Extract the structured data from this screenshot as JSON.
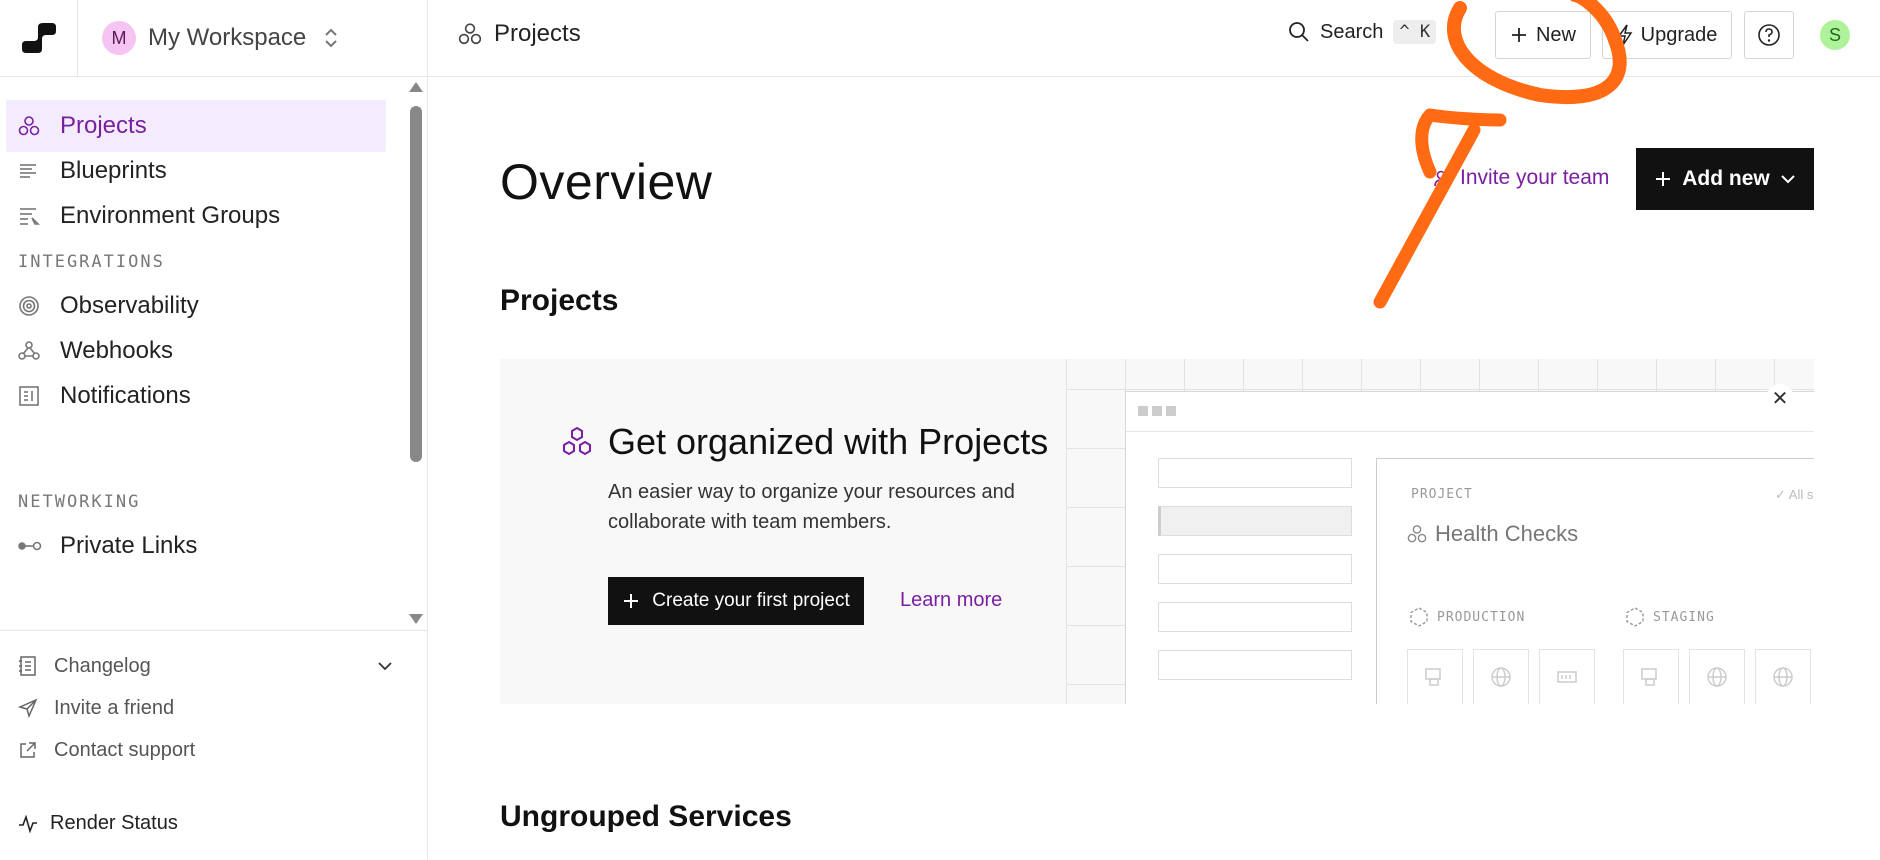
{
  "workspace": {
    "avatar_letter": "M",
    "name": "My Workspace"
  },
  "sidebar": {
    "items": [
      {
        "label": "Projects",
        "icon": "projects-icon",
        "active": true
      },
      {
        "label": "Blueprints",
        "icon": "blueprints-icon"
      },
      {
        "label": "Environment Groups",
        "icon": "env-groups-icon"
      }
    ],
    "integrations_heading": "INTEGRATIONS",
    "integrations": [
      {
        "label": "Observability",
        "icon": "observability-icon"
      },
      {
        "label": "Webhooks",
        "icon": "webhooks-icon"
      },
      {
        "label": "Notifications",
        "icon": "notifications-icon"
      }
    ],
    "networking_heading": "NETWORKING",
    "networking": [
      {
        "label": "Private Links",
        "icon": "private-links-icon"
      }
    ],
    "footer": {
      "changelog": "Changelog",
      "invite": "Invite a friend",
      "support": "Contact support",
      "status": "Render Status"
    }
  },
  "topbar": {
    "breadcrumb": "Projects",
    "search_label": "Search",
    "search_shortcut": "^ K",
    "new_label": "New",
    "upgrade_label": "Upgrade",
    "user_initial": "S"
  },
  "main": {
    "title": "Overview",
    "invite_label": "Invite your team",
    "add_new_label": "Add new",
    "projects_heading": "Projects",
    "promo": {
      "title": "Get organized with Projects",
      "description": "An easier way to organize your resources and collaborate with team members.",
      "create_label": "Create your first project",
      "learn_label": "Learn more",
      "illustration": {
        "project_label": "PROJECT",
        "project_name": "Health Checks",
        "all_label": "✓ All s",
        "env_production": "PRODUCTION",
        "env_staging": "STAGING"
      }
    },
    "ungrouped_heading": "Ungrouped Services"
  },
  "colors": {
    "accent": "#7b1fa2",
    "active_bg": "#f3ecfd",
    "annotation": "#ff6a13"
  }
}
